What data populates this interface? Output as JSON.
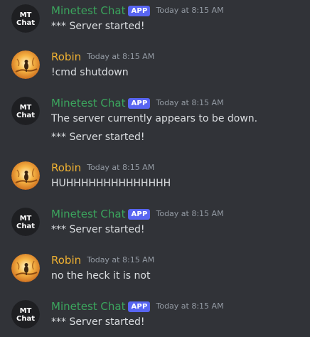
{
  "colors": {
    "background": "#313338",
    "bot_name": "#3ba55d",
    "user_name": "#f0b232",
    "app_badge": "#5865f2",
    "timestamp": "#949ba4",
    "message_text": "#dbdee1"
  },
  "messages": [
    {
      "author": "Minetest Chat",
      "badge": "APP",
      "timestamp": "Today at 8:15 AM",
      "avatar_icon": "mt-chat-avatar-icon",
      "lines": [
        "*** Server started!"
      ]
    },
    {
      "author": "Robin",
      "timestamp": "Today at 8:15 AM",
      "avatar_icon": "robin-avatar-icon",
      "lines": [
        "!cmd shutdown"
      ]
    },
    {
      "author": "Minetest Chat",
      "badge": "APP",
      "timestamp": "Today at 8:15 AM",
      "avatar_icon": "mt-chat-avatar-icon",
      "lines": [
        "The server currently appears to be down.",
        "*** Server started!"
      ]
    },
    {
      "author": "Robin",
      "timestamp": "Today at 8:15 AM",
      "avatar_icon": "robin-avatar-icon",
      "lines": [
        "HUHHHHHHHHHHHHHH"
      ]
    },
    {
      "author": "Minetest Chat",
      "badge": "APP",
      "timestamp": "Today at 8:15 AM",
      "avatar_icon": "mt-chat-avatar-icon",
      "lines": [
        "*** Server started!"
      ]
    },
    {
      "author": "Robin",
      "timestamp": "Today at 8:15 AM",
      "avatar_icon": "robin-avatar-icon",
      "lines": [
        "no the heck it is not"
      ]
    },
    {
      "author": "Minetest Chat",
      "badge": "APP",
      "timestamp": "Today at 8:15 AM",
      "avatar_icon": "mt-chat-avatar-icon",
      "lines": [
        "*** Server started!"
      ]
    }
  ],
  "avatar_text": {
    "mt_top": "MT",
    "mt_bottom": "Chat"
  }
}
